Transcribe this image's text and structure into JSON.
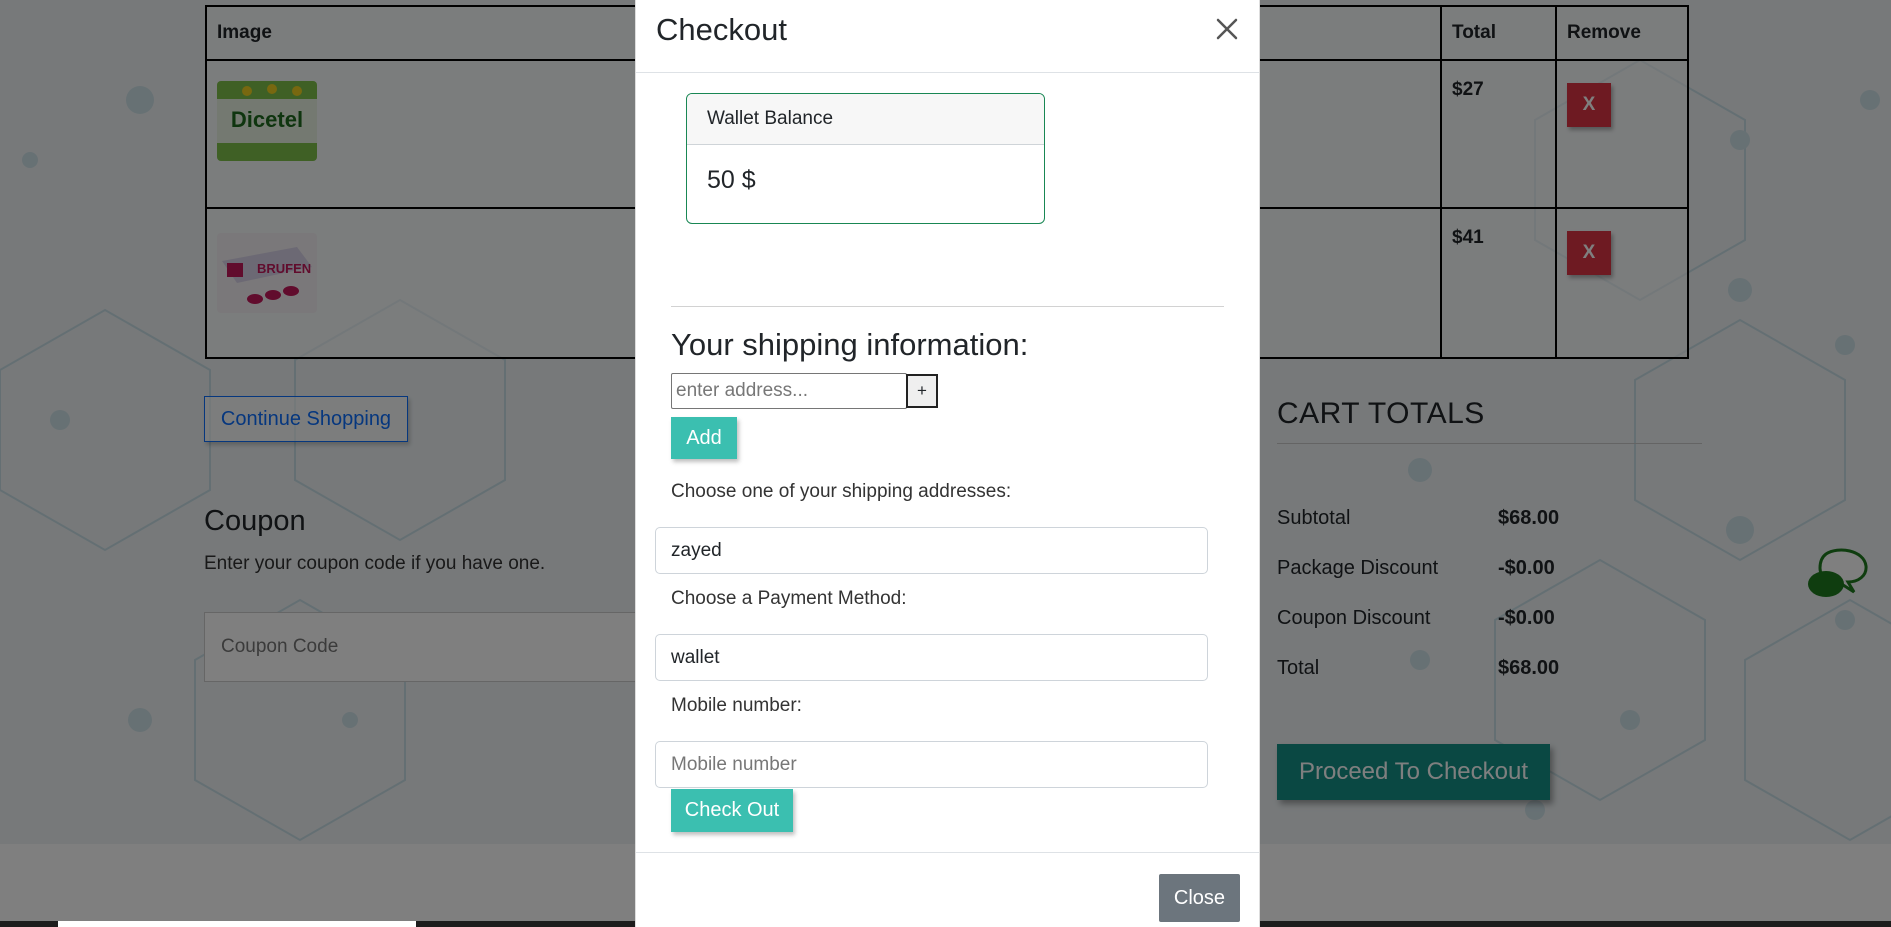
{
  "cart": {
    "headers": {
      "image": "Image",
      "total": "Total",
      "remove": "Remove"
    },
    "rows": [
      {
        "product": "Dicetel",
        "total": "$27",
        "remove_label": "X"
      },
      {
        "product": "Brufen",
        "total": "$41",
        "remove_label": "X"
      }
    ]
  },
  "continue_shopping": "Continue Shopping",
  "coupon": {
    "title": "Coupon",
    "description": "Enter your coupon code if you have one.",
    "placeholder": "Coupon Code"
  },
  "cart_totals": {
    "title": "CART TOTALS",
    "rows": [
      {
        "label": "Subtotal",
        "value": "$68.00"
      },
      {
        "label": "Package Discount",
        "value": "-$0.00"
      },
      {
        "label": "Coupon Discount",
        "value": "-$0.00"
      },
      {
        "label": "Total",
        "value": "$68.00"
      }
    ],
    "proceed_label": "Proceed To Checkout"
  },
  "modal": {
    "title": "Checkout",
    "wallet": {
      "header": "Wallet Balance",
      "balance": "50 $"
    },
    "shipping_title": "Your shipping information:",
    "address_placeholder": "enter address...",
    "plus_label": "+",
    "add_label": "Add",
    "choose_address_label": "Choose one of your shipping addresses:",
    "selected_address": "zayed",
    "payment_label": "Choose a Payment Method:",
    "selected_payment": "wallet",
    "mobile_label": "Mobile number:",
    "mobile_placeholder": "Mobile number",
    "checkout_label": "Check Out",
    "close_label": "Close"
  },
  "colors": {
    "accent_teal": "#3bbfb0",
    "proceed_teal": "#159087",
    "danger": "#dc3545",
    "chat_green": "#1e7a1e"
  }
}
